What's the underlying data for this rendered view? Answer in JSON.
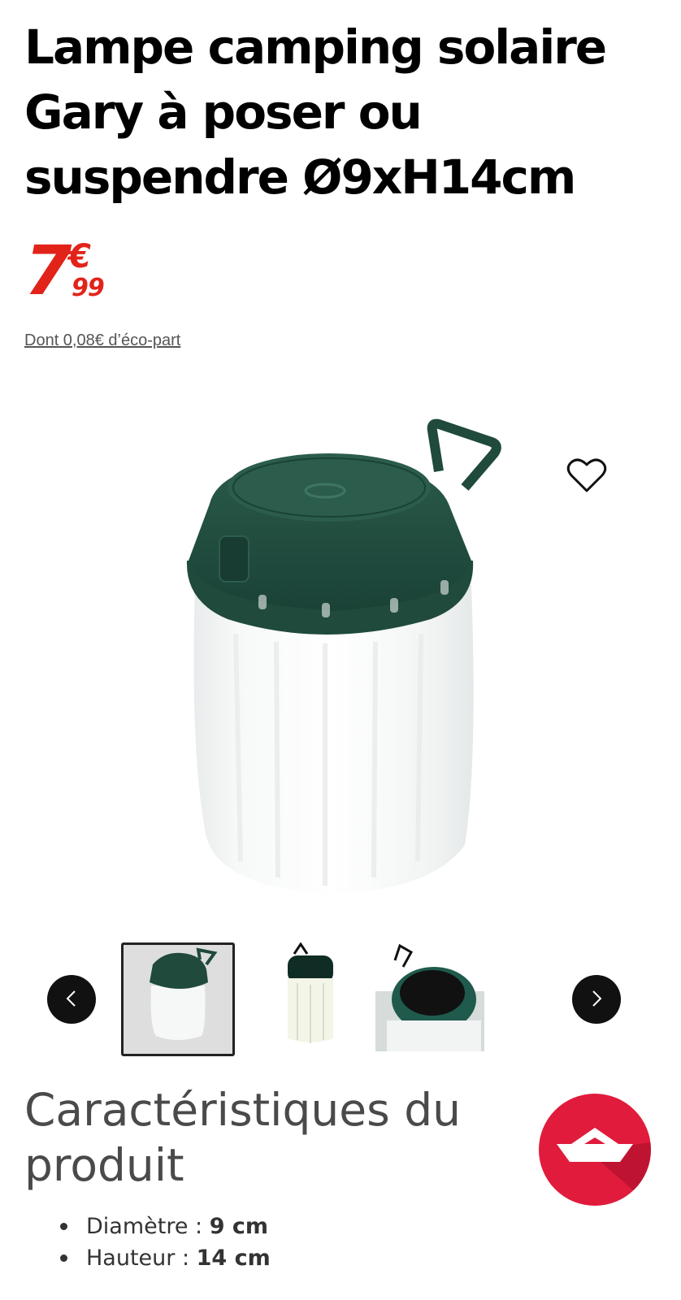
{
  "product": {
    "title": "Lampe camping solaire Gary à poser ou suspendre Ø9xH14cm",
    "price": {
      "integer": "7",
      "currency": "€",
      "decimals": "99"
    },
    "eco_part": "Dont 0,08€ d’éco-part"
  },
  "gallery": {
    "icons": {
      "prev": "chevron-left-icon",
      "next": "chevron-right-icon",
      "favorite": "heart-icon"
    },
    "thumbnails": [
      {
        "name": "lamp-front"
      },
      {
        "name": "lamp-glowing"
      },
      {
        "name": "lamp-top-solar"
      }
    ]
  },
  "characteristics": {
    "heading": "Caractéristiques du produit",
    "items": [
      {
        "label": "Diamètre : ",
        "value": "9 cm"
      },
      {
        "label": "Hauteur : ",
        "value": "14 cm"
      }
    ]
  },
  "colors": {
    "price_red": "#e2231a",
    "lamp_green": "#1f4a3c",
    "badge_red": "#e01b3c"
  }
}
